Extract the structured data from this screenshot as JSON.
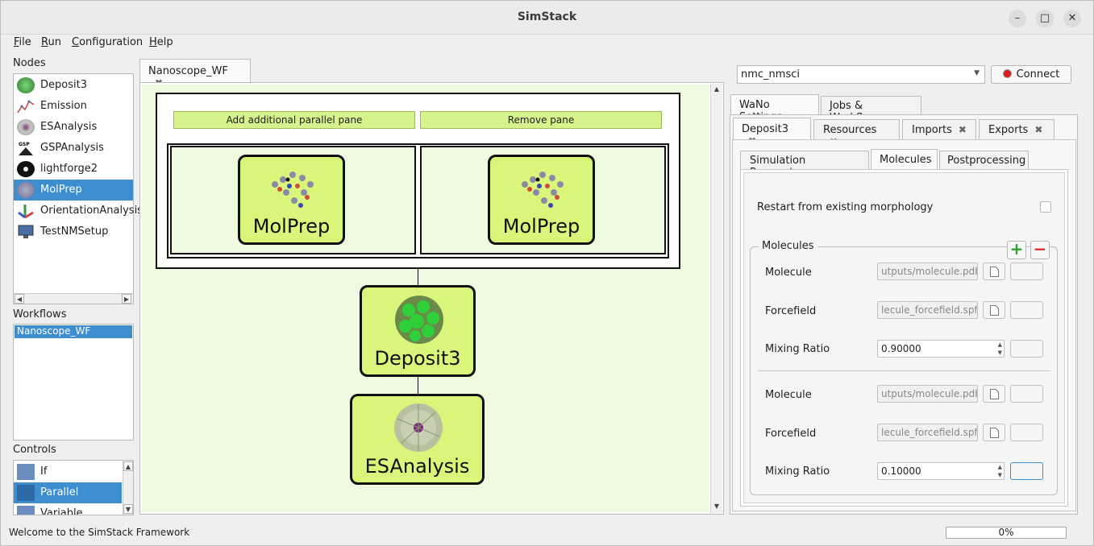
{
  "window": {
    "title": "SimStack",
    "minimize": "–",
    "maximize": "□",
    "close": "✕"
  },
  "menu": [
    {
      "key": "F",
      "rest": "ile"
    },
    {
      "key": "R",
      "rest": "un"
    },
    {
      "key": "C",
      "rest": "onfiguration"
    },
    {
      "key": "H",
      "rest": "elp"
    }
  ],
  "nodes": {
    "label": "Nodes",
    "items": [
      {
        "label": "Deposit3",
        "icon": "deposit-icon",
        "color": "#3f9a3f"
      },
      {
        "label": "Emission",
        "icon": "emission-icon",
        "color": "#c04848"
      },
      {
        "label": "ESAnalysis",
        "icon": "esanalysis-icon",
        "color": "#a9a9a9"
      },
      {
        "label": "GSPAnalysis",
        "icon": "gsp-icon",
        "color": "#222222"
      },
      {
        "label": "lightforge2",
        "icon": "lightforge-icon",
        "color": "#111111"
      },
      {
        "label": "MolPrep",
        "icon": "molprep-icon",
        "color": "#7a7aa0"
      },
      {
        "label": "OrientationAnalysis",
        "icon": "orientation-icon",
        "color": "#d04040"
      },
      {
        "label": "TestNMSetup",
        "icon": "monitor-icon",
        "color": "#4a6fa5"
      }
    ],
    "selected": "MolPrep"
  },
  "workflows": {
    "label": "Workflows",
    "items": [
      "Nanoscope_WF"
    ]
  },
  "controls": {
    "label": "Controls",
    "items": [
      "If",
      "Parallel",
      "Variable"
    ],
    "selected": "Parallel"
  },
  "editor": {
    "tab": "Nanoscope_WF",
    "add_pane": "Add additional parallel pane",
    "remove_pane": "Remove pane",
    "nodes": [
      "MolPrep",
      "MolPrep",
      "Deposit3",
      "ESAnalysis"
    ]
  },
  "right": {
    "server": "nmc_nmsci",
    "connect": "Connect",
    "top_tabs": [
      "WaNo Settings",
      "Jobs & Workflows"
    ],
    "wano_tabs": [
      "Deposit3",
      "Resources",
      "Imports",
      "Exports"
    ],
    "sub_tabs": [
      "Simulation Parameters",
      "Molecules",
      "Postprocessing"
    ],
    "restart_label": "Restart from existing morphology",
    "molecules_group": "Molecules",
    "rows": [
      {
        "label": "Molecule",
        "value": "utputs/molecule.pdb"
      },
      {
        "label": "Forcefield",
        "value": "lecule_forcefield.spf"
      },
      {
        "label": "Mixing Ratio",
        "value": "0.90000"
      },
      {
        "label": "Molecule",
        "value": "utputs/molecule.pdb"
      },
      {
        "label": "Forcefield",
        "value": "lecule_forcefield.spf"
      },
      {
        "label": "Mixing Ratio",
        "value": "0.10000"
      }
    ]
  },
  "status": {
    "message": "Welcome to the SimStack Framework",
    "progress": "0%",
    "progress_value": 0
  },
  "colors": {
    "accent": "#3d8ed1",
    "node_fill": "#d9f57a",
    "pane_fill": "#eefbe0"
  }
}
